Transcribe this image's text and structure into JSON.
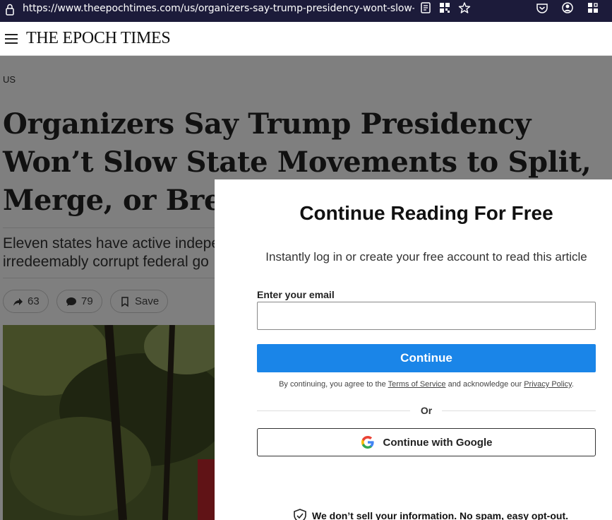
{
  "browser": {
    "url": "https://www.theepochtimes.com/us/organizers-say-trump-presidency-wont-slow-state-mo"
  },
  "site": {
    "logo": "THE EPOCH TIMES"
  },
  "article": {
    "section": "US",
    "headline": "Organizers Say Trump Presidency Won’t Slow State Movements to Split, Merge, or Break Away",
    "dek_line1": "Eleven states have active indepe",
    "dek_line2": "irredeemably corrupt federal go",
    "share_count": "63",
    "comment_count": "79",
    "save_label": "Save"
  },
  "modal": {
    "title": "Continue Reading For Free",
    "subtitle": "Instantly log in or create your free account to read this article",
    "email_label": "Enter your email",
    "email_value": "",
    "continue_label": "Continue",
    "legal_prefix": "By continuing, you agree to the ",
    "terms_label": "Terms of Service",
    "legal_middle": " and acknowledge our ",
    "privacy_label": "Privacy Policy",
    "legal_suffix": ".",
    "or_label": "Or",
    "google_label": "Continue with Google",
    "no_spam": "We don’t sell your information. No spam, easy opt-out."
  },
  "colors": {
    "browser_bar": "#1c1b3a",
    "accent_blue": "#1a85e8"
  }
}
